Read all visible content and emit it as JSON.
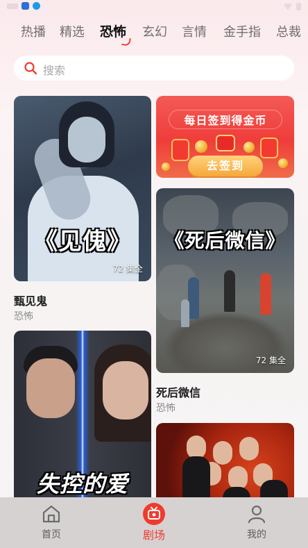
{
  "tabs": [
    "热播",
    "精选",
    "恐怖",
    "玄幻",
    "言情",
    "金手指",
    "总裁"
  ],
  "active_tab": "恐怖",
  "search": {
    "placeholder": "搜索"
  },
  "signin_banner": {
    "headline": "每日签到得金币",
    "button_label": "去签到"
  },
  "cards": [
    {
      "poster_title": "《见傀》",
      "episodes": "72 集全",
      "title": "甄见鬼",
      "genre": "恐怖"
    },
    {
      "poster_title": "《死后微信》",
      "episodes": "72 集全",
      "title": "死后微信",
      "genre": "恐怖"
    },
    {
      "poster_title": "失控的爱"
    }
  ],
  "bottom_nav": [
    {
      "label": "首页",
      "icon": "home-icon",
      "active": false
    },
    {
      "label": "剧场",
      "icon": "theater-icon",
      "active": true
    },
    {
      "label": "我的",
      "icon": "profile-icon",
      "active": false
    }
  ],
  "colors": {
    "accent": "#ef3b2d",
    "nav_background": "#d6d2d2",
    "page_background": "#f6f4f4"
  }
}
